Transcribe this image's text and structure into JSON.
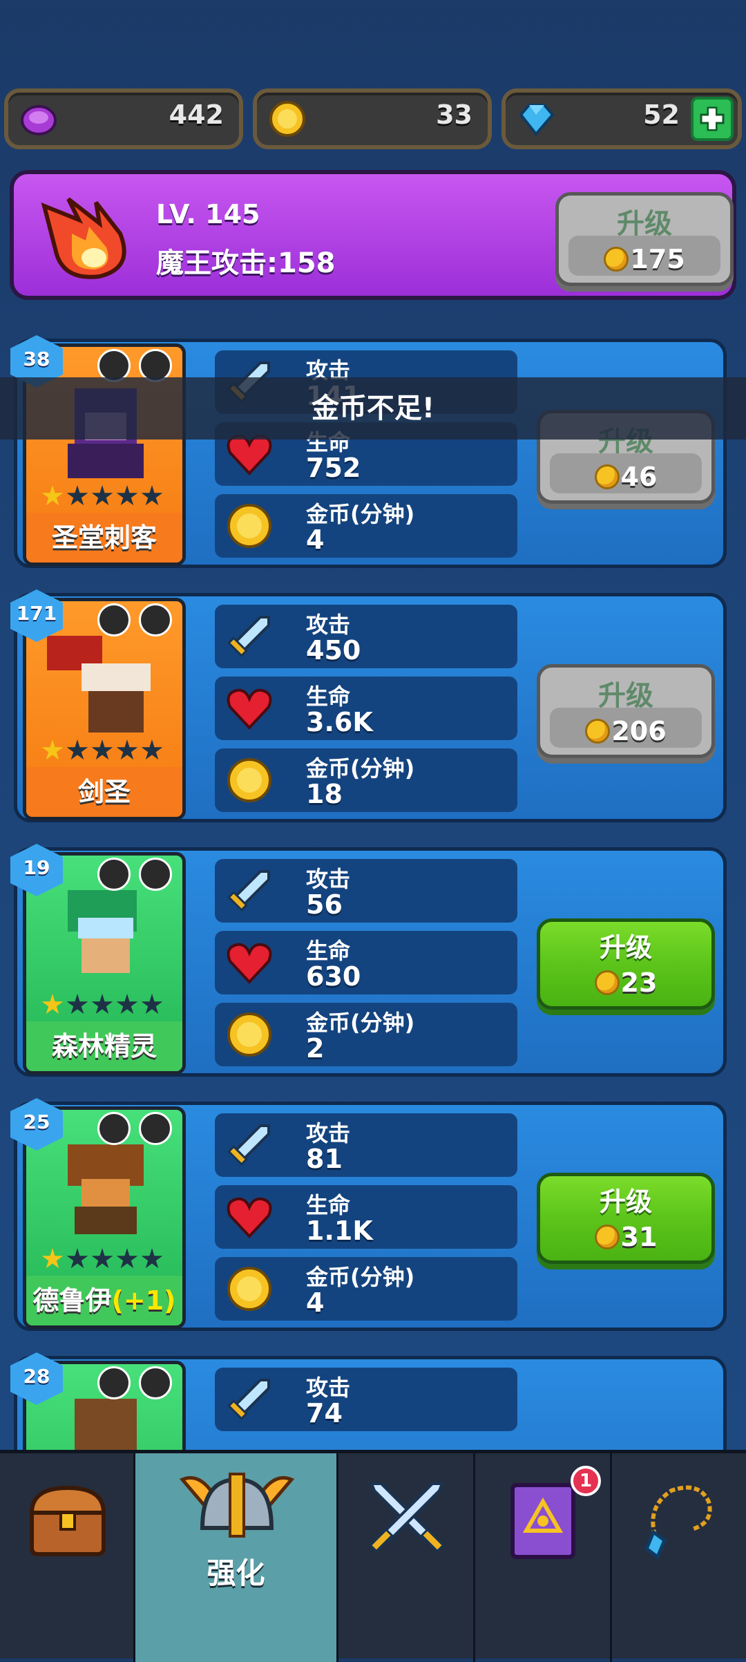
{
  "resources": {
    "gem_purple": "442",
    "coins": "33",
    "diamonds": "52"
  },
  "banner": {
    "level": "LV. 145",
    "attack": "魔王攻击:158",
    "upgrade_label": "升级",
    "upgrade_cost": "175"
  },
  "toast": "金币不足!",
  "stat_labels": {
    "attack": "攻击",
    "life": "生命",
    "coins": "金币(分钟)"
  },
  "heroes": [
    {
      "level": "38",
      "name": "圣堂刺客",
      "attack": "141",
      "life": "752",
      "coins": "4",
      "upgrade_label": "升级",
      "cost": "46",
      "stars": 1
    },
    {
      "level": "171",
      "name": "剑圣",
      "attack": "450",
      "life": "3.6K",
      "coins": "18",
      "upgrade_label": "升级",
      "cost": "206",
      "stars": 1
    },
    {
      "level": "19",
      "name": "森林精灵",
      "attack": "56",
      "life": "630",
      "coins": "2",
      "upgrade_label": "升级",
      "cost": "23",
      "stars": 1
    },
    {
      "level": "25",
      "name": "德鲁伊",
      "name_bonus": "(+1)",
      "attack": "81",
      "life": "1.1K",
      "coins": "4",
      "upgrade_label": "升级",
      "cost": "31",
      "stars": 1
    },
    {
      "level": "28",
      "attack": "74"
    }
  ],
  "nav": {
    "selected_label": "强化",
    "spellbook_badge": "1"
  },
  "colors": {
    "banner": "#b646e8",
    "green_button": "#5cc41a",
    "gray_button": "#b7b7b7"
  }
}
